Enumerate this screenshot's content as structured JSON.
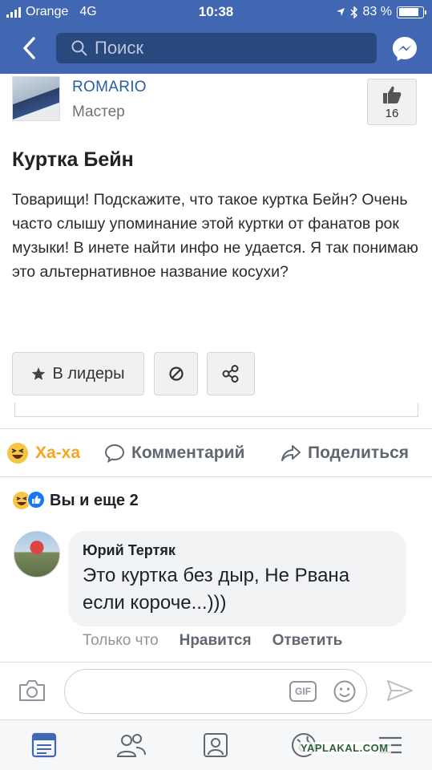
{
  "status_bar": {
    "carrier": "Orange",
    "network": "4G",
    "time": "10:38",
    "battery": "83 %",
    "battery_level": 0.83
  },
  "nav": {
    "search_placeholder": "Поиск",
    "icons": [
      "chevron-left-icon",
      "search-icon",
      "messenger-icon"
    ]
  },
  "post_card": {
    "user_name": "ROMARIO",
    "user_rank": "Мастер",
    "like_count": "16",
    "title": "Куртка Бейн",
    "body": "Товарищи! Подскажите, что такое куртка Бейн? Очень часто слышу упоминание этой куртки от фанатов рок музыки! В инете найти инфо не удается. Я так понимаю это альтернативное название косухи?",
    "leaders_label": "В лидеры",
    "icons": [
      "star-icon",
      "ban-icon",
      "share-nodes-icon",
      "thumbs-up-icon"
    ]
  },
  "actions": {
    "haha_label": "Ха-ха",
    "comment_label": "Комментарий",
    "share_label": "Поделиться"
  },
  "reactions": {
    "summary": "Вы и еще 2"
  },
  "comment": {
    "author": "Юрий Тертяк",
    "text": "Это куртка без дыр, Не Рвана если короче...)))",
    "time": "Только что",
    "like_label": "Нравится",
    "reply_label": "Ответить"
  },
  "composer": {
    "gif_label": "GIF"
  },
  "watermark": "YAPLAKAL.COM",
  "colors": {
    "facebook_blue": "#4267b2",
    "search_bg": "#29487d",
    "haha_yellow": "#f5a623",
    "link_blue": "#2a5ca8"
  }
}
